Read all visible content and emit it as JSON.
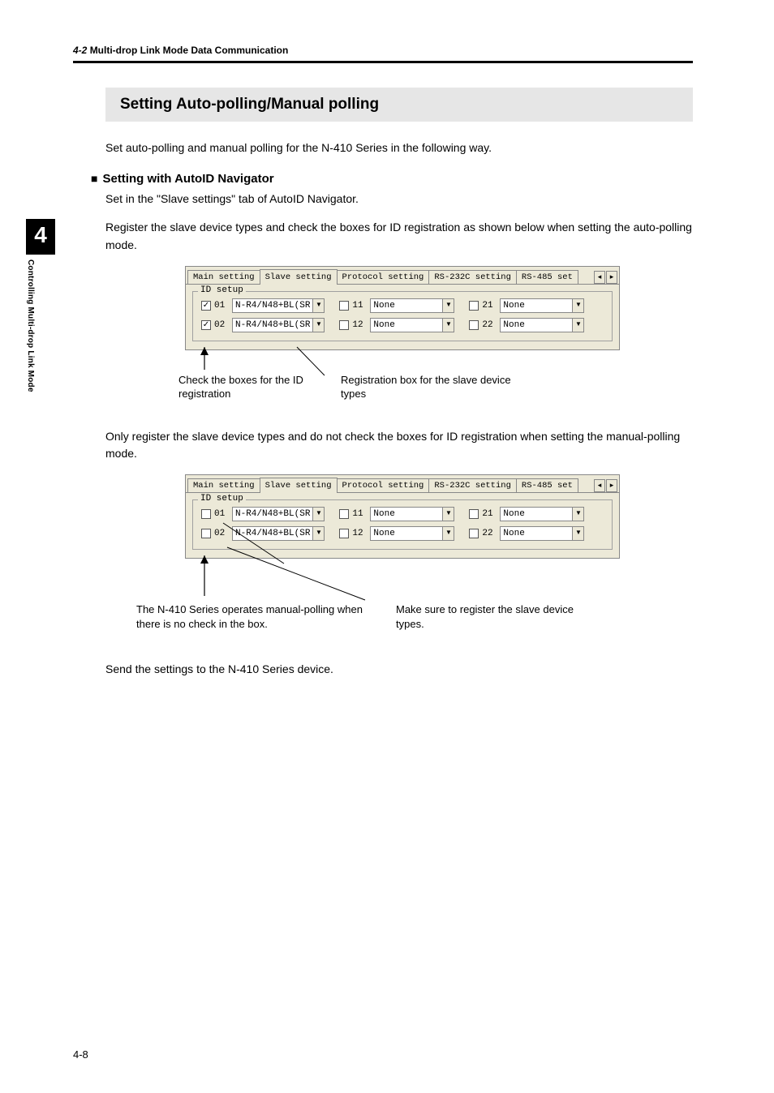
{
  "header": {
    "section_number": "4-2",
    "section_title": "Multi-drop Link Mode Data Communication"
  },
  "chapter": {
    "number": "4",
    "vtext": "Controlling Multi-drop Link Mode"
  },
  "title": "Setting Auto-polling/Manual polling",
  "intro": "Set auto-polling and manual polling for the N-410 Series in the following way.",
  "sub1": {
    "heading": "Setting with AutoID Navigator",
    "line1": "Set in the \"Slave settings\" tab of AutoID Navigator.",
    "line2": "Register the slave device types and check the boxes for ID registration as shown below when setting the auto-polling mode."
  },
  "fig1": {
    "tabs": [
      "Main setting",
      "Slave setting",
      "Protocol setting",
      "RS-232C setting",
      "RS-485 set"
    ],
    "group_label": "ID setup",
    "rows": [
      {
        "checked": true,
        "id": "01",
        "device": "N-R4/N48+BL(SR",
        "mid_id": "11",
        "mid_val": "None",
        "right_id": "21",
        "right_val": "None"
      },
      {
        "checked": true,
        "id": "02",
        "device": "N-R4/N48+BL(SR",
        "mid_id": "12",
        "mid_val": "None",
        "right_id": "22",
        "right_val": "None"
      }
    ],
    "caption_left": "Check the boxes for the ID registration",
    "caption_right": "Registration box for the slave device types"
  },
  "mid_text": "Only register the slave device types and do not check the boxes for ID registration when setting the manual-polling mode.",
  "fig2": {
    "tabs": [
      "Main setting",
      "Slave setting",
      "Protocol setting",
      "RS-232C setting",
      "RS-485 set"
    ],
    "group_label": "ID setup",
    "rows": [
      {
        "checked": false,
        "id": "01",
        "device": "N-R4/N48+BL(SR",
        "mid_id": "11",
        "mid_val": "None",
        "right_id": "21",
        "right_val": "None"
      },
      {
        "checked": false,
        "id": "02",
        "device": "N-R4/N48+BL(SR",
        "mid_id": "12",
        "mid_val": "None",
        "right_id": "22",
        "right_val": "None"
      }
    ],
    "caption_left": "The N-410 Series operates manual-polling when there is no check in the box.",
    "caption_right": "Make sure to register the slave device types."
  },
  "outro": "Send the settings to the N-410 Series device.",
  "page_number": "4-8"
}
